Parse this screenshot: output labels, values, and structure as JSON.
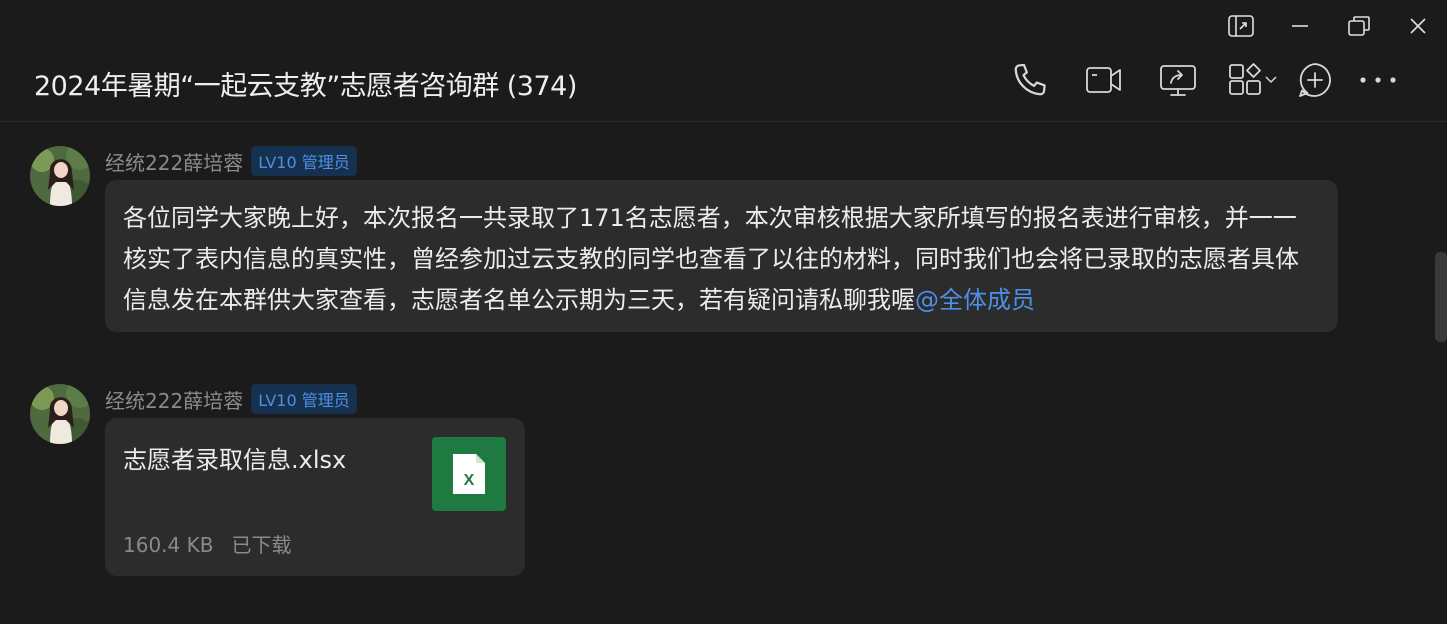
{
  "window": {
    "title": "2024年暑期“一起云支教”志愿者咨询群 (374)"
  },
  "window_controls": [
    "pin-window-icon",
    "minimize-icon",
    "restore-icon",
    "close-icon"
  ],
  "toolbar": [
    "phone-icon",
    "video-icon",
    "screen-share-icon",
    "apps-grid-icon",
    "add-circle-icon",
    "more-icon"
  ],
  "messages": [
    {
      "sender": "经统222薛培蓉",
      "badge": "LV10 管理员",
      "text": "各位同学大家晚上好，本次报名一共录取了171名志愿者，本次审核根据大家所填写的报名表进行审核，并一一核实了表内信息的真实性，曾经参加过云支教的同学也查看了以往的材料，同时我们也会将已录取的志愿者具体信息发在本群供大家查看，志愿者名单公示期为三天，若有疑问请私聊我喔",
      "mention": "@全体成员"
    },
    {
      "sender": "经统222薛培蓉",
      "badge": "LV10 管理员",
      "file": {
        "name": "志愿者录取信息.xlsx",
        "size": "160.4 KB",
        "status": "已下载",
        "icon_letter": "X"
      }
    }
  ],
  "colors": {
    "background": "#1b1b1b",
    "bubble": "#2c2c2c",
    "accent": "#4d8fe8",
    "excel": "#1e7a40"
  }
}
